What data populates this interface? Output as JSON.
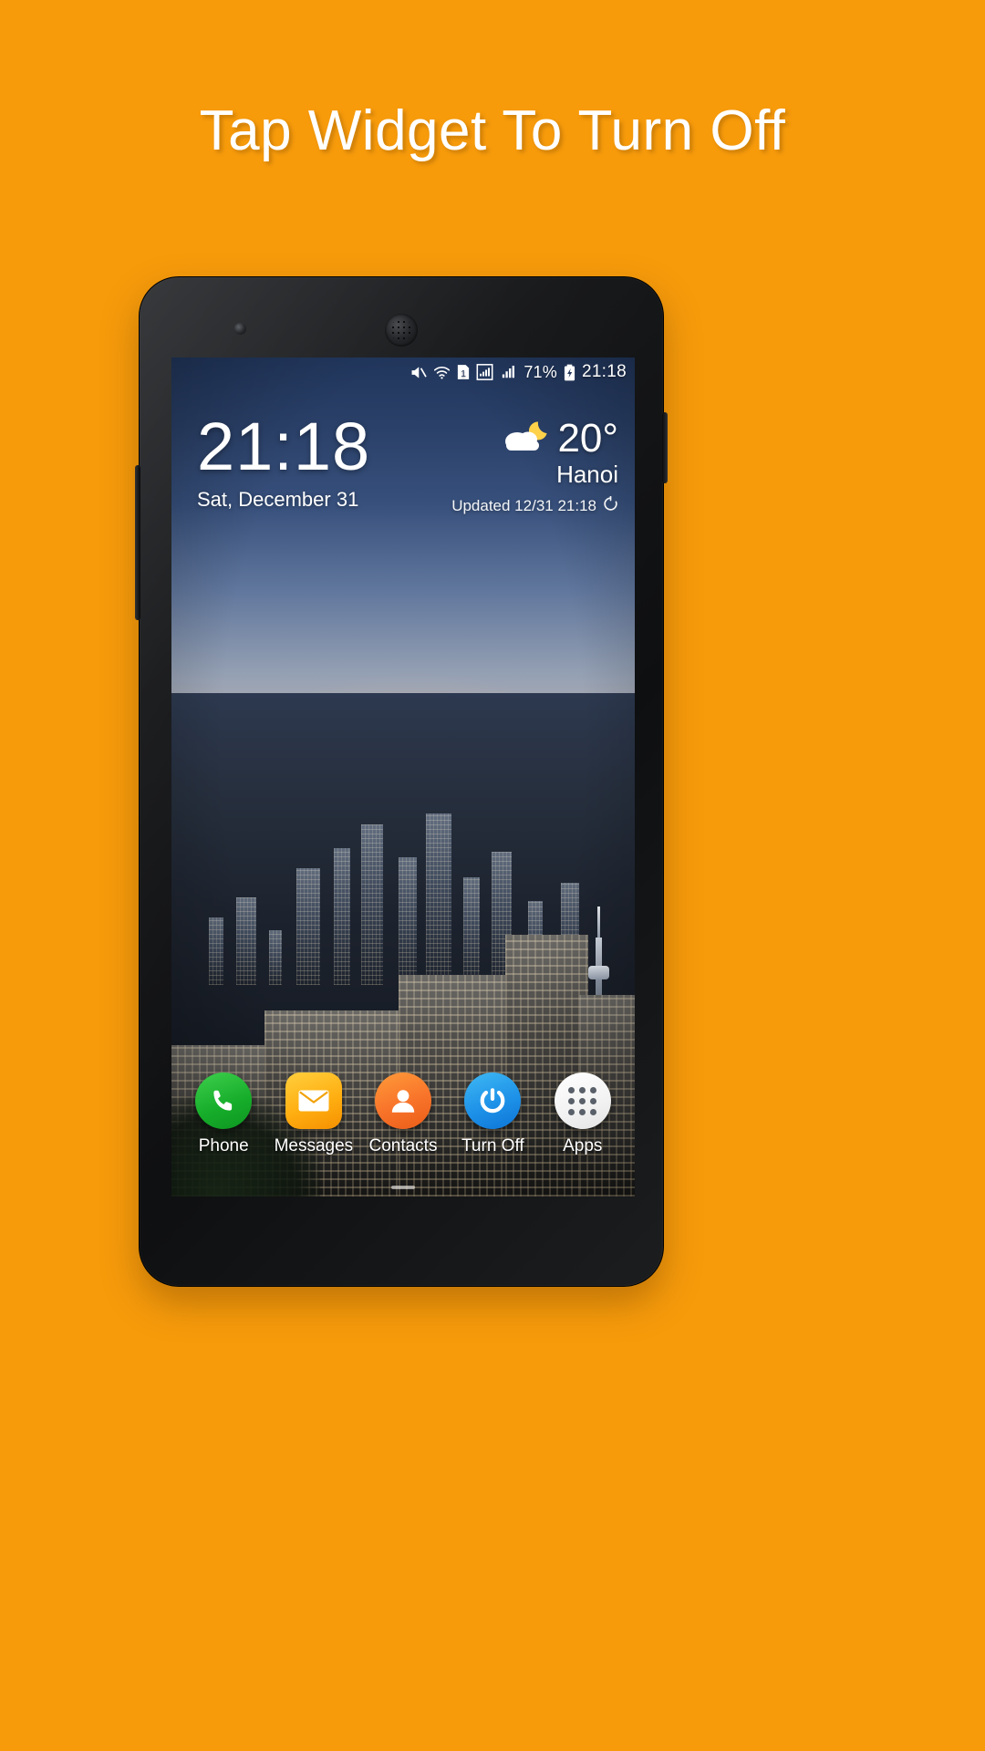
{
  "page": {
    "background_color": "#F79B0B",
    "headline": "Tap Widget To Turn Off"
  },
  "phone": {
    "device_color": "#17181a",
    "components": {
      "earpiece": "earpiece-speaker",
      "front_camera": "front-camera",
      "power_button": "power-button",
      "volume_button": "volume-button"
    }
  },
  "screen": {
    "status_bar": {
      "icons": [
        {
          "name": "mute-icon",
          "glyph": "mute"
        },
        {
          "name": "wifi-icon",
          "glyph": "wifi"
        },
        {
          "name": "sim-card-icon",
          "glyph": "1"
        },
        {
          "name": "signal-sim1-icon",
          "glyph": "signal-boxed"
        },
        {
          "name": "signal-sim2-icon",
          "glyph": "signal"
        }
      ],
      "battery_percent": "71%",
      "battery_state": "charging",
      "time": "21:18"
    },
    "clock_widget": {
      "time": "21:18",
      "date": "Sat, December 31"
    },
    "weather_widget": {
      "condition_icon": "night-partly-cloudy-icon",
      "temperature": "20°",
      "city": "Hanoi",
      "updated": "Updated 12/31 21:18",
      "refresh_icon": "refresh-icon"
    },
    "dock": {
      "items": [
        {
          "label": "Phone",
          "icon": "phone-icon",
          "color": "#16ad2a"
        },
        {
          "label": "Messages",
          "icon": "envelope-icon",
          "color": "#ffaf12"
        },
        {
          "label": "Contacts",
          "icon": "person-icon",
          "color": "#f8732a"
        },
        {
          "label": "Turn Off",
          "icon": "power-icon",
          "color": "#1e92e8"
        },
        {
          "label": "Apps",
          "icon": "app-grid-icon",
          "color": "#ffffff"
        }
      ]
    }
  }
}
